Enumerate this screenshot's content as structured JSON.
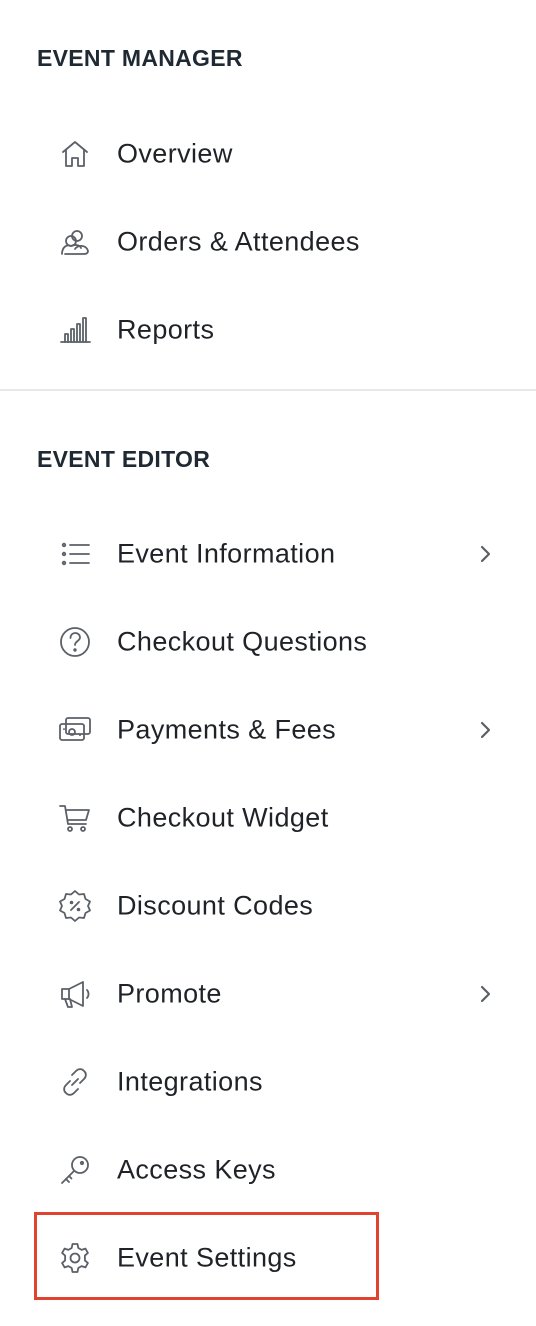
{
  "sections": {
    "manager": {
      "heading": "EVENT MANAGER",
      "items": [
        {
          "label": "Overview",
          "icon": "home-icon"
        },
        {
          "label": "Orders & Attendees",
          "icon": "attendees-icon"
        },
        {
          "label": "Reports",
          "icon": "bar-chart-icon"
        }
      ]
    },
    "editor": {
      "heading": "EVENT EDITOR",
      "items": [
        {
          "label": "Event Information",
          "icon": "list-icon",
          "has_submenu": true
        },
        {
          "label": "Checkout Questions",
          "icon": "question-circle-icon",
          "has_submenu": false
        },
        {
          "label": "Payments & Fees",
          "icon": "cash-icon",
          "has_submenu": true
        },
        {
          "label": "Checkout Widget",
          "icon": "cart-icon",
          "has_submenu": false
        },
        {
          "label": "Discount Codes",
          "icon": "discount-badge-icon",
          "has_submenu": false
        },
        {
          "label": "Promote",
          "icon": "megaphone-icon",
          "has_submenu": true
        },
        {
          "label": "Integrations",
          "icon": "link-icon",
          "has_submenu": false
        },
        {
          "label": "Access Keys",
          "icon": "key-icon",
          "has_submenu": false
        },
        {
          "label": "Event Settings",
          "icon": "gear-icon",
          "has_submenu": false,
          "highlighted": true
        }
      ]
    }
  },
  "colors": {
    "highlight_border": "#e0432f",
    "icon": "#5b6068",
    "text": "#1f2328",
    "divider": "#e6e8eb"
  }
}
